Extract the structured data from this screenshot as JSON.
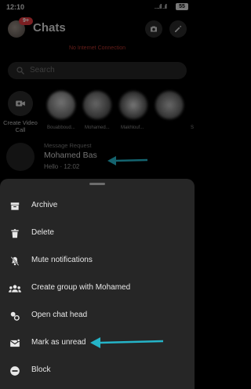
{
  "status_bar": {
    "time": "12:10",
    "signal": ".....ıll ..ıll",
    "battery": "55"
  },
  "header": {
    "title": "Chats",
    "badge": "9+"
  },
  "banner": {
    "no_connection": "No Internet Connection"
  },
  "search": {
    "placeholder": "Search"
  },
  "stories": {
    "create_label": "Create Video Call",
    "names": [
      "Bouabboud...",
      "Mohamed...",
      "Makhlouf...",
      "S"
    ]
  },
  "message_request": {
    "tag": "Message Request",
    "name": "Mohamed Bas",
    "preview": "Hello · 12:02"
  },
  "menu": {
    "items": [
      {
        "label": "Archive",
        "icon": "archive-icon"
      },
      {
        "label": "Delete",
        "icon": "trash-icon"
      },
      {
        "label": "Mute notifications",
        "icon": "bell-off-icon"
      },
      {
        "label": "Create group with Mohamed",
        "icon": "group-icon"
      },
      {
        "label": "Open chat head",
        "icon": "chat-head-icon"
      },
      {
        "label": "Mark as unread",
        "icon": "mark-unread-icon"
      },
      {
        "label": "Block",
        "icon": "block-icon"
      }
    ]
  },
  "colors": {
    "accent_arrow": "#25b4c8",
    "banner_text": "#b5352f",
    "badge": "#e0393e",
    "sheet_bg": "#262626"
  }
}
